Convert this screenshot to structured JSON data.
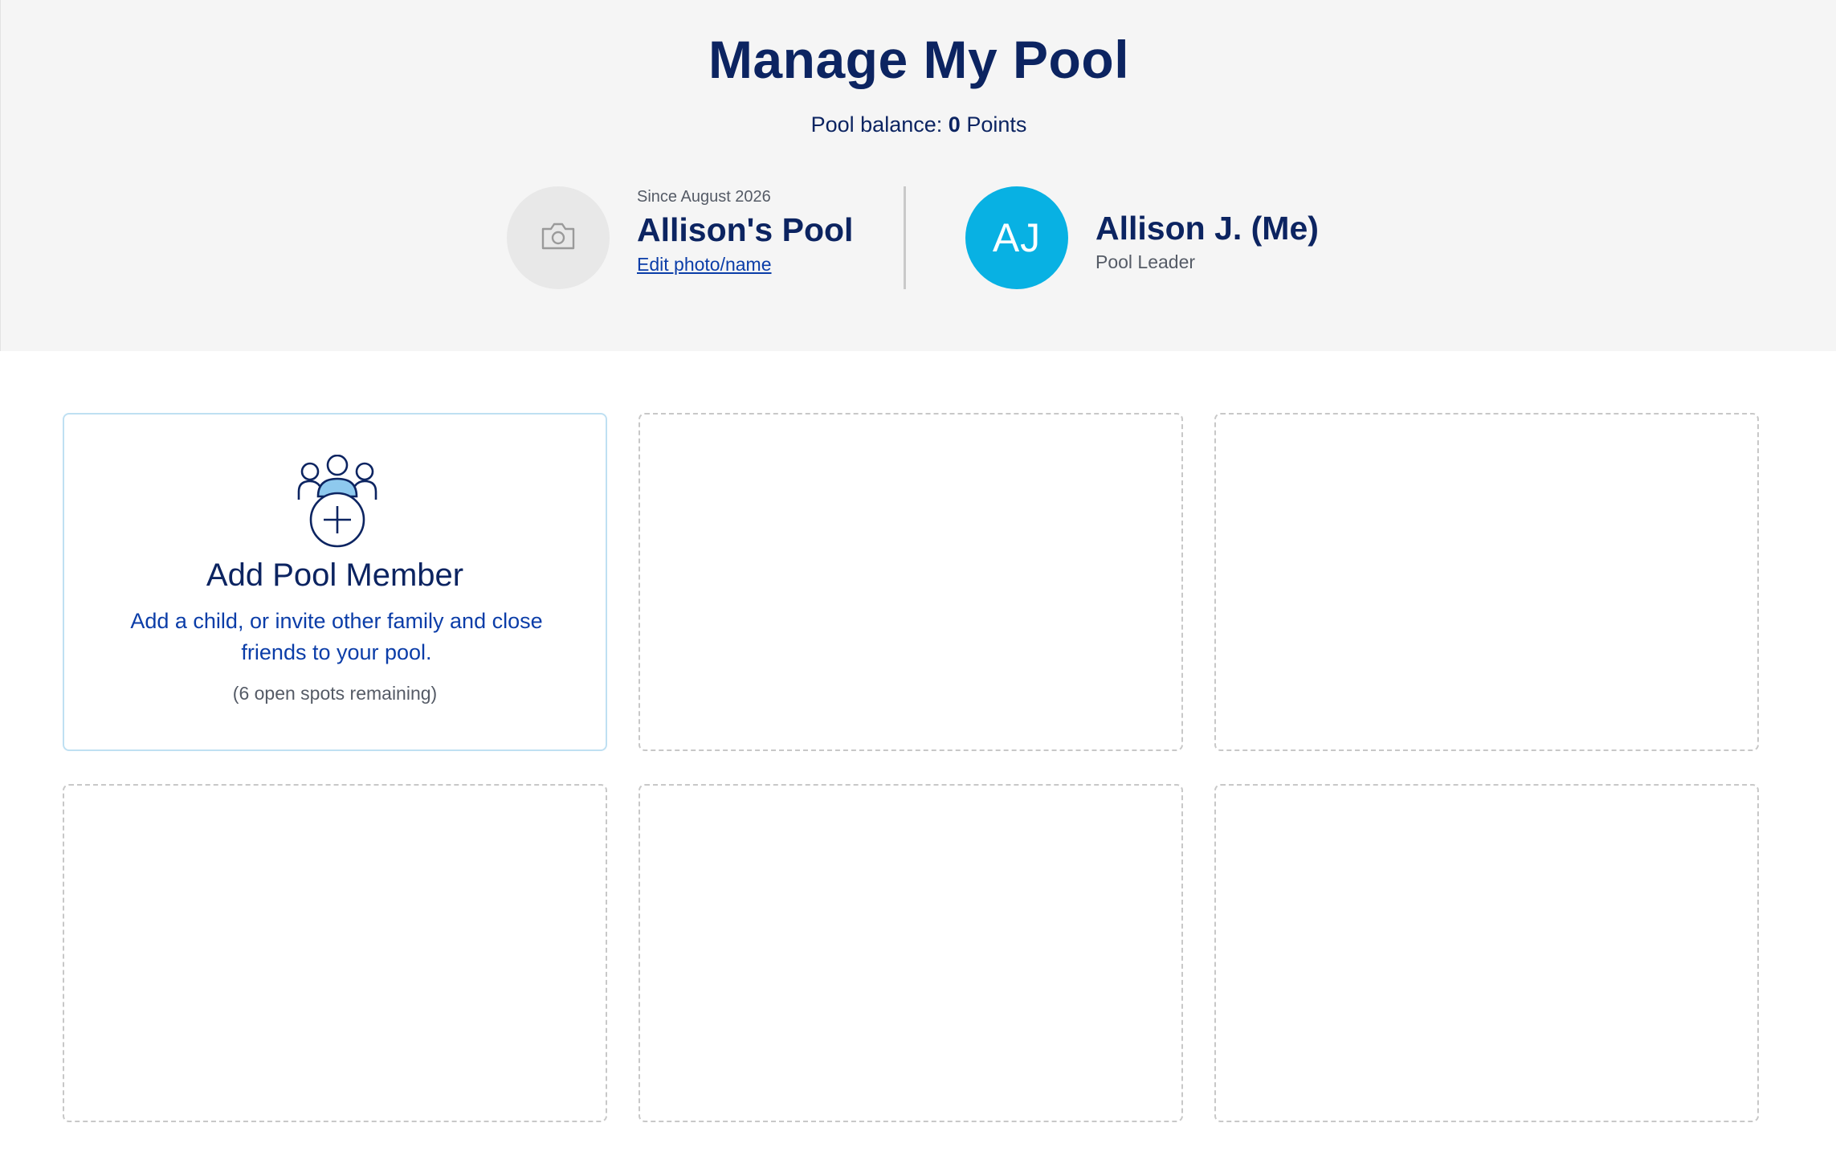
{
  "header": {
    "title": "Manage My Pool",
    "balance_label": "Pool balance:",
    "balance_value": "0",
    "balance_unit": "Points"
  },
  "pool": {
    "photo_icon": "camera-icon",
    "since": "Since August 2026",
    "name": "Allison's Pool",
    "edit_link": "Edit photo/name"
  },
  "leader": {
    "initials": "AJ",
    "name": "Allison J. (Me)",
    "role": "Pool Leader",
    "avatar_color": "#08b1e3"
  },
  "add_member": {
    "icon": "group-add-icon",
    "title": "Add Pool Member",
    "description": "Add a child, or invite other family and close friends to your pool.",
    "spots": "(6 open spots remaining)"
  },
  "colors": {
    "navy": "#0c2461",
    "link_blue": "#0b3da8",
    "header_bg": "#f5f5f5"
  }
}
